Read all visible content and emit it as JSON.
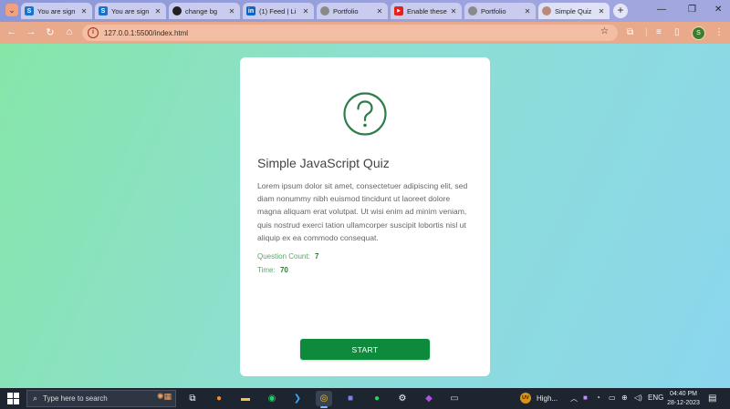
{
  "browser": {
    "tabs": [
      {
        "label": "You are sign",
        "favicon": "S",
        "favicon_color": "#1a73c9",
        "close": "✕"
      },
      {
        "label": "You are sign",
        "favicon": "S",
        "favicon_color": "#1a73c9",
        "close": "✕"
      },
      {
        "label": "change bg",
        "favicon": "",
        "favicon_color": "#222222",
        "close": "✕"
      },
      {
        "label": "(1) Feed | Li",
        "favicon": "in",
        "favicon_color": "#0a66c2",
        "close": "✕"
      },
      {
        "label": "Portfolio",
        "favicon": "",
        "favicon_color": "#8a8a8a",
        "close": "✕"
      },
      {
        "label": "Enable these",
        "favicon": "▶",
        "favicon_color": "#e62117",
        "close": "✕"
      },
      {
        "label": "Portfolio",
        "favicon": "",
        "favicon_color": "#8a8a8a",
        "close": "✕"
      },
      {
        "label": "Simple Quiz",
        "favicon": "",
        "favicon_color": "#b98a7a",
        "close": "✕"
      }
    ],
    "new_tab": "+",
    "url": "127.0.0.1:5500/index.html",
    "profile_initial": "S"
  },
  "quiz": {
    "title": "Simple JavaScript Quiz",
    "description": "Lorem ipsum dolor sit amet, consectetuer adipiscing elit, sed diam nonummy nibh euismod tincidunt ut laoreet dolore magna aliquam erat volutpat. Ut wisi enim ad minim veniam, quis nostrud exerci tation ullamcorper suscipit lobortis nisl ut aliquip ex ea commodo consequat.",
    "question_count_label": "Question Count:",
    "question_count_value": "7",
    "time_label": "Time:",
    "time_value": "70",
    "start_label": "START",
    "accent_color": "#0e8a3c"
  },
  "taskbar": {
    "search_placeholder": "Type here to search",
    "weather_badge": "UV",
    "weather_text": "High...",
    "language": "ENG",
    "time": "04:40 PM",
    "date": "28-12-2023"
  }
}
